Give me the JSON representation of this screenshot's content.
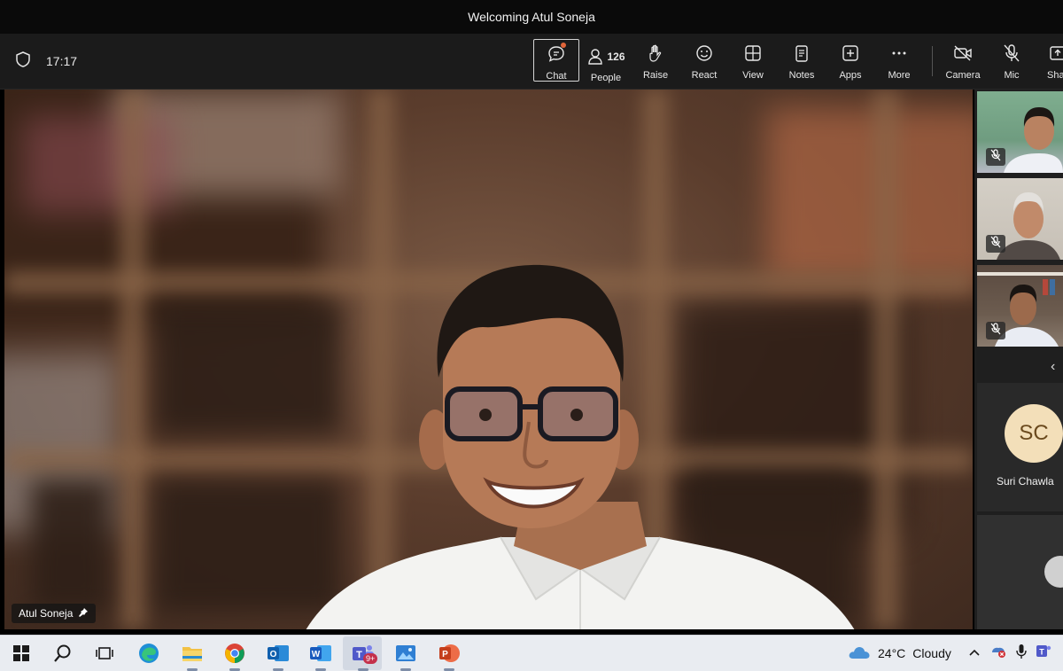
{
  "window": {
    "title": "Welcoming Atul Soneja"
  },
  "toolbar": {
    "time": "17:17",
    "people_count": "126",
    "buttons": {
      "chat": "Chat",
      "people": "People",
      "raise": "Raise",
      "react": "React",
      "view": "View",
      "notes": "Notes",
      "apps": "Apps",
      "more": "More",
      "camera": "Camera",
      "mic": "Mic",
      "share": "Sha"
    }
  },
  "main_video": {
    "participant_name": "Atul Soneja"
  },
  "side_panel": {
    "avatar_initials": "SC",
    "avatar_name": "Suri Chawla"
  },
  "taskbar": {
    "weather_temp": "24°C",
    "weather_desc": "Cloudy",
    "teams_badge": "9+"
  },
  "colors": {
    "toolbar_bg": "#1b1b1b",
    "notification_dot": "#e0653a",
    "avatar_bg": "#f3dfb9",
    "taskbar_bg": "#e9ecf1"
  }
}
